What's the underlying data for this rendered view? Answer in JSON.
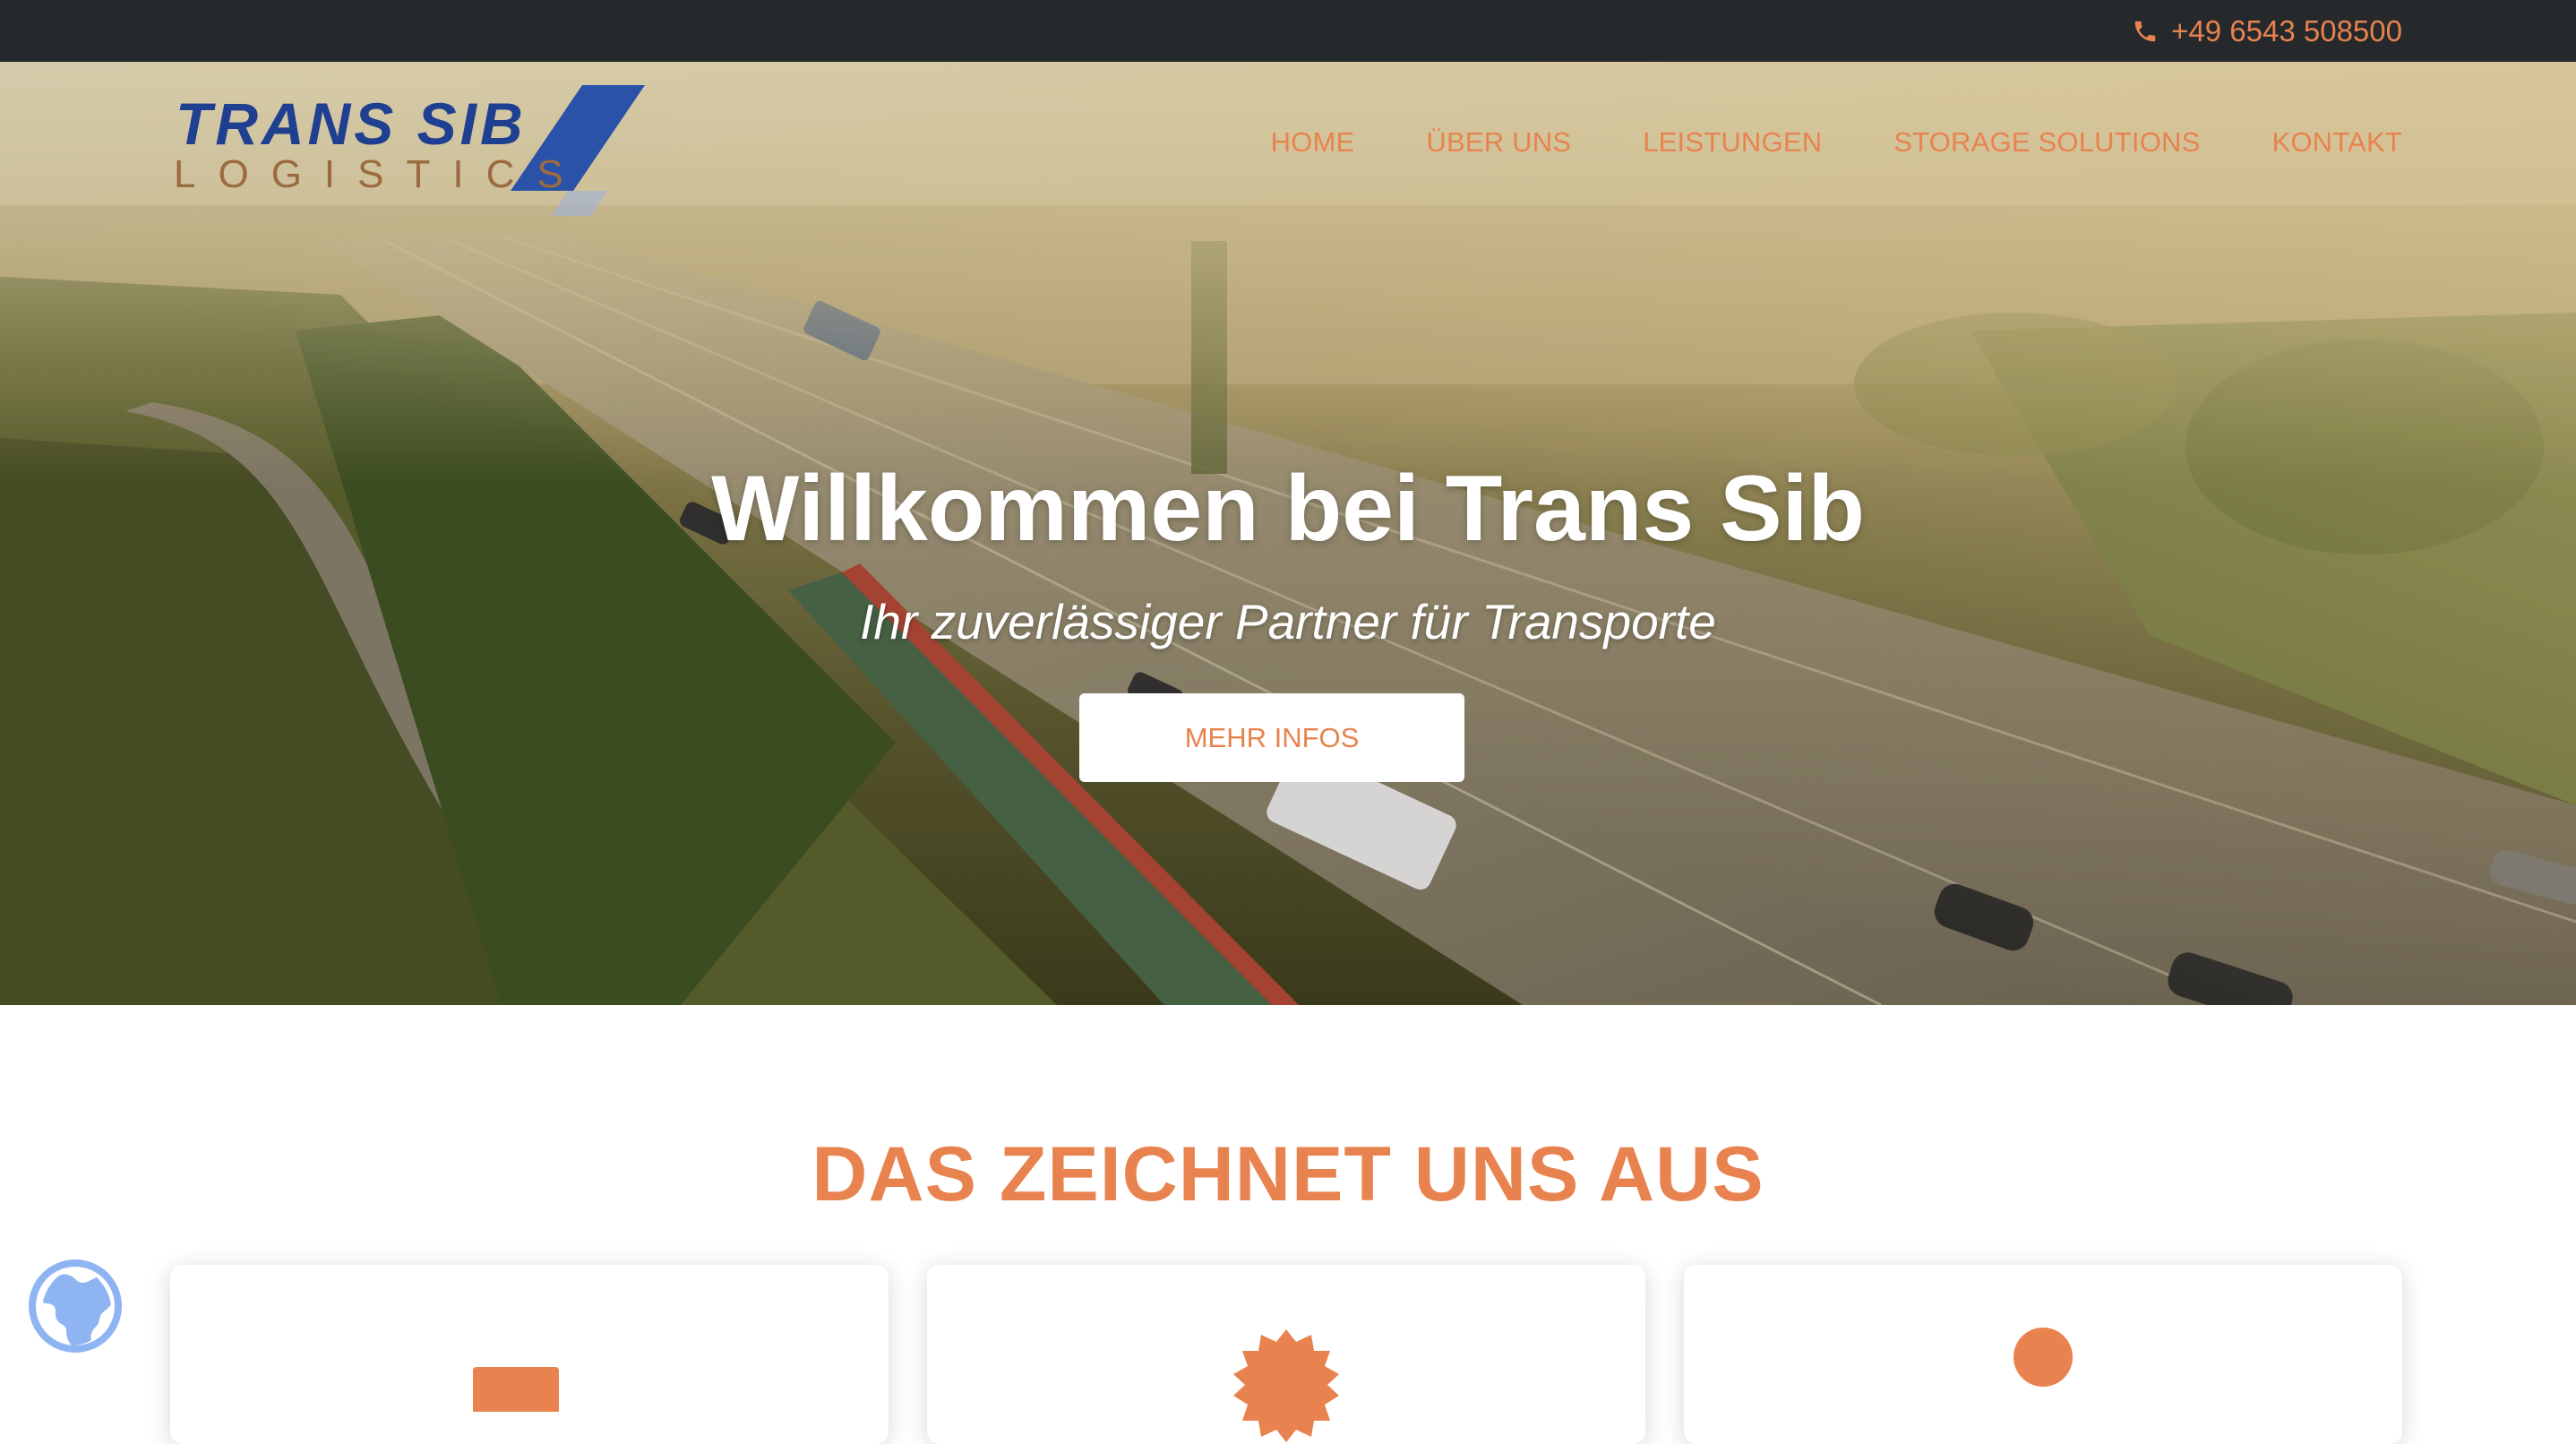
{
  "topbar": {
    "phone_icon": "phone-icon",
    "phone": "+49 6543 508500"
  },
  "logo": {
    "line1": "TRANS SIB",
    "line2": "LOGISTICS"
  },
  "nav": {
    "items": [
      {
        "label": "HOME"
      },
      {
        "label": "ÜBER UNS"
      },
      {
        "label": "LEISTUNGEN"
      },
      {
        "label": "STORAGE SOLUTIONS"
      },
      {
        "label": "KONTAKT"
      }
    ]
  },
  "hero": {
    "title": "Willkommen bei Trans Sib",
    "subtitle": "Ihr zuverlässiger Partner für Transporte",
    "button": "MEHR INFOS"
  },
  "features": {
    "title": "DAS ZEICHNET UNS AUS",
    "cards": [
      {
        "icon": "rectangle-icon"
      },
      {
        "icon": "badge-icon"
      },
      {
        "icon": "circle-icon"
      }
    ]
  },
  "widget": {
    "icon": "globe-icon"
  },
  "colors": {
    "accent": "#e8834f",
    "topbar": "#25292c",
    "logo_blue": "#1f3f91"
  }
}
